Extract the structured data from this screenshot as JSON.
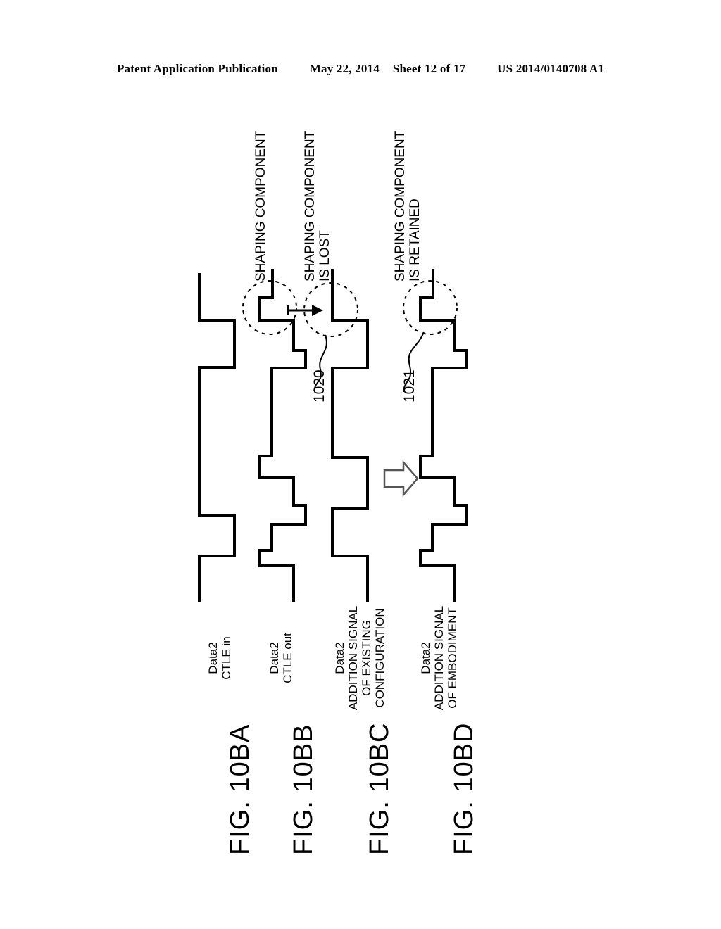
{
  "header": {
    "publication": "Patent Application Publication",
    "date": "May 22, 2014",
    "sheet": "Sheet 12 of 17",
    "patent_number": "US 2014/0140708 A1"
  },
  "figures": [
    {
      "id": "10BA",
      "title": "FIG. 10BA",
      "caption_line1": "Data2",
      "caption_line2": "CTLE in",
      "caption_line3": "",
      "caption_line4": ""
    },
    {
      "id": "10BB",
      "title": "FIG. 10BB",
      "caption_line1": "Data2",
      "caption_line2": "CTLE out",
      "caption_line3": "",
      "caption_line4": ""
    },
    {
      "id": "10BC",
      "title": "FIG. 10BC",
      "caption_line1": "Data2",
      "caption_line2": "ADDITION SIGNAL",
      "caption_line3": "OF EXISTING",
      "caption_line4": "CONFIGURATION"
    },
    {
      "id": "10BD",
      "title": "FIG. 10BD",
      "caption_line1": "Data2",
      "caption_line2": "ADDITION SIGNAL",
      "caption_line3": "OF EMBODIMENT",
      "caption_line4": ""
    }
  ],
  "annotations": [
    {
      "id": "shaping-component",
      "line1": "SHAPING COMPONENT",
      "line2": ""
    },
    {
      "id": "shaping-component-lost",
      "line1": "SHAPING COMPONENT",
      "line2": "IS LOST"
    },
    {
      "id": "shaping-component-retained",
      "line1": "SHAPING COMPONENT",
      "line2": "IS RETAINED"
    }
  ],
  "reference_numerals": [
    {
      "id": "ref-1020",
      "label": "1020"
    },
    {
      "id": "ref-1021",
      "label": "1021"
    }
  ],
  "colors": {
    "ink": "#000000",
    "paper": "#ffffff",
    "arrow_outline": "#555555"
  }
}
